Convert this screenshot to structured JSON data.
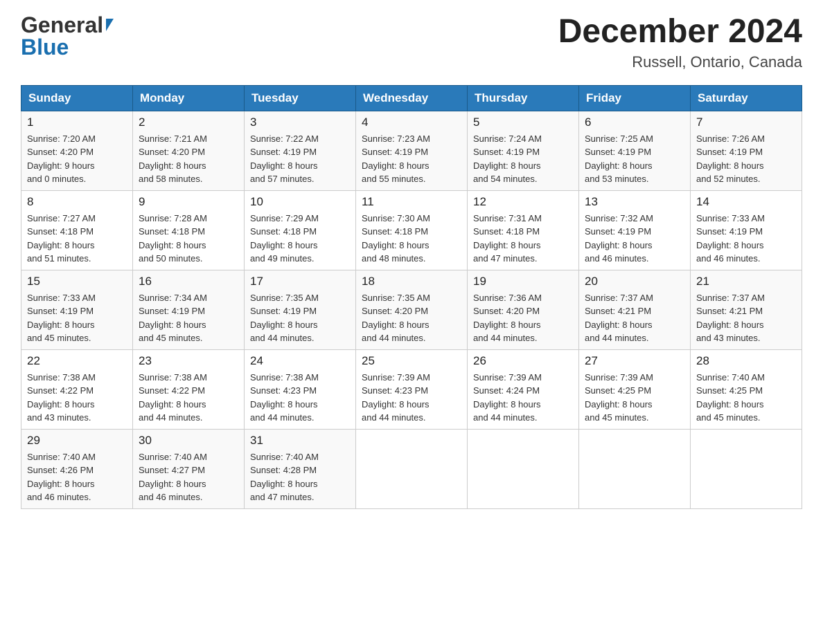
{
  "header": {
    "logo_general": "General",
    "logo_blue": "Blue",
    "title": "December 2024",
    "subtitle": "Russell, Ontario, Canada"
  },
  "days_of_week": [
    "Sunday",
    "Monday",
    "Tuesday",
    "Wednesday",
    "Thursday",
    "Friday",
    "Saturday"
  ],
  "weeks": [
    [
      {
        "num": "1",
        "sunrise": "7:20 AM",
        "sunset": "4:20 PM",
        "daylight_h": "9",
        "daylight_m": "0"
      },
      {
        "num": "2",
        "sunrise": "7:21 AM",
        "sunset": "4:20 PM",
        "daylight_h": "8",
        "daylight_m": "58"
      },
      {
        "num": "3",
        "sunrise": "7:22 AM",
        "sunset": "4:19 PM",
        "daylight_h": "8",
        "daylight_m": "57"
      },
      {
        "num": "4",
        "sunrise": "7:23 AM",
        "sunset": "4:19 PM",
        "daylight_h": "8",
        "daylight_m": "55"
      },
      {
        "num": "5",
        "sunrise": "7:24 AM",
        "sunset": "4:19 PM",
        "daylight_h": "8",
        "daylight_m": "54"
      },
      {
        "num": "6",
        "sunrise": "7:25 AM",
        "sunset": "4:19 PM",
        "daylight_h": "8",
        "daylight_m": "53"
      },
      {
        "num": "7",
        "sunrise": "7:26 AM",
        "sunset": "4:19 PM",
        "daylight_h": "8",
        "daylight_m": "52"
      }
    ],
    [
      {
        "num": "8",
        "sunrise": "7:27 AM",
        "sunset": "4:18 PM",
        "daylight_h": "8",
        "daylight_m": "51"
      },
      {
        "num": "9",
        "sunrise": "7:28 AM",
        "sunset": "4:18 PM",
        "daylight_h": "8",
        "daylight_m": "50"
      },
      {
        "num": "10",
        "sunrise": "7:29 AM",
        "sunset": "4:18 PM",
        "daylight_h": "8",
        "daylight_m": "49"
      },
      {
        "num": "11",
        "sunrise": "7:30 AM",
        "sunset": "4:18 PM",
        "daylight_h": "8",
        "daylight_m": "48"
      },
      {
        "num": "12",
        "sunrise": "7:31 AM",
        "sunset": "4:18 PM",
        "daylight_h": "8",
        "daylight_m": "47"
      },
      {
        "num": "13",
        "sunrise": "7:32 AM",
        "sunset": "4:19 PM",
        "daylight_h": "8",
        "daylight_m": "46"
      },
      {
        "num": "14",
        "sunrise": "7:33 AM",
        "sunset": "4:19 PM",
        "daylight_h": "8",
        "daylight_m": "46"
      }
    ],
    [
      {
        "num": "15",
        "sunrise": "7:33 AM",
        "sunset": "4:19 PM",
        "daylight_h": "8",
        "daylight_m": "45"
      },
      {
        "num": "16",
        "sunrise": "7:34 AM",
        "sunset": "4:19 PM",
        "daylight_h": "8",
        "daylight_m": "45"
      },
      {
        "num": "17",
        "sunrise": "7:35 AM",
        "sunset": "4:19 PM",
        "daylight_h": "8",
        "daylight_m": "44"
      },
      {
        "num": "18",
        "sunrise": "7:35 AM",
        "sunset": "4:20 PM",
        "daylight_h": "8",
        "daylight_m": "44"
      },
      {
        "num": "19",
        "sunrise": "7:36 AM",
        "sunset": "4:20 PM",
        "daylight_h": "8",
        "daylight_m": "44"
      },
      {
        "num": "20",
        "sunrise": "7:37 AM",
        "sunset": "4:21 PM",
        "daylight_h": "8",
        "daylight_m": "44"
      },
      {
        "num": "21",
        "sunrise": "7:37 AM",
        "sunset": "4:21 PM",
        "daylight_h": "8",
        "daylight_m": "43"
      }
    ],
    [
      {
        "num": "22",
        "sunrise": "7:38 AM",
        "sunset": "4:22 PM",
        "daylight_h": "8",
        "daylight_m": "43"
      },
      {
        "num": "23",
        "sunrise": "7:38 AM",
        "sunset": "4:22 PM",
        "daylight_h": "8",
        "daylight_m": "44"
      },
      {
        "num": "24",
        "sunrise": "7:38 AM",
        "sunset": "4:23 PM",
        "daylight_h": "8",
        "daylight_m": "44"
      },
      {
        "num": "25",
        "sunrise": "7:39 AM",
        "sunset": "4:23 PM",
        "daylight_h": "8",
        "daylight_m": "44"
      },
      {
        "num": "26",
        "sunrise": "7:39 AM",
        "sunset": "4:24 PM",
        "daylight_h": "8",
        "daylight_m": "44"
      },
      {
        "num": "27",
        "sunrise": "7:39 AM",
        "sunset": "4:25 PM",
        "daylight_h": "8",
        "daylight_m": "45"
      },
      {
        "num": "28",
        "sunrise": "7:40 AM",
        "sunset": "4:25 PM",
        "daylight_h": "8",
        "daylight_m": "45"
      }
    ],
    [
      {
        "num": "29",
        "sunrise": "7:40 AM",
        "sunset": "4:26 PM",
        "daylight_h": "8",
        "daylight_m": "46"
      },
      {
        "num": "30",
        "sunrise": "7:40 AM",
        "sunset": "4:27 PM",
        "daylight_h": "8",
        "daylight_m": "46"
      },
      {
        "num": "31",
        "sunrise": "7:40 AM",
        "sunset": "4:28 PM",
        "daylight_h": "8",
        "daylight_m": "47"
      },
      null,
      null,
      null,
      null
    ]
  ],
  "labels": {
    "sunrise": "Sunrise:",
    "sunset": "Sunset:",
    "daylight": "Daylight:",
    "hours": "hours",
    "and": "and",
    "minutes": "minutes."
  }
}
